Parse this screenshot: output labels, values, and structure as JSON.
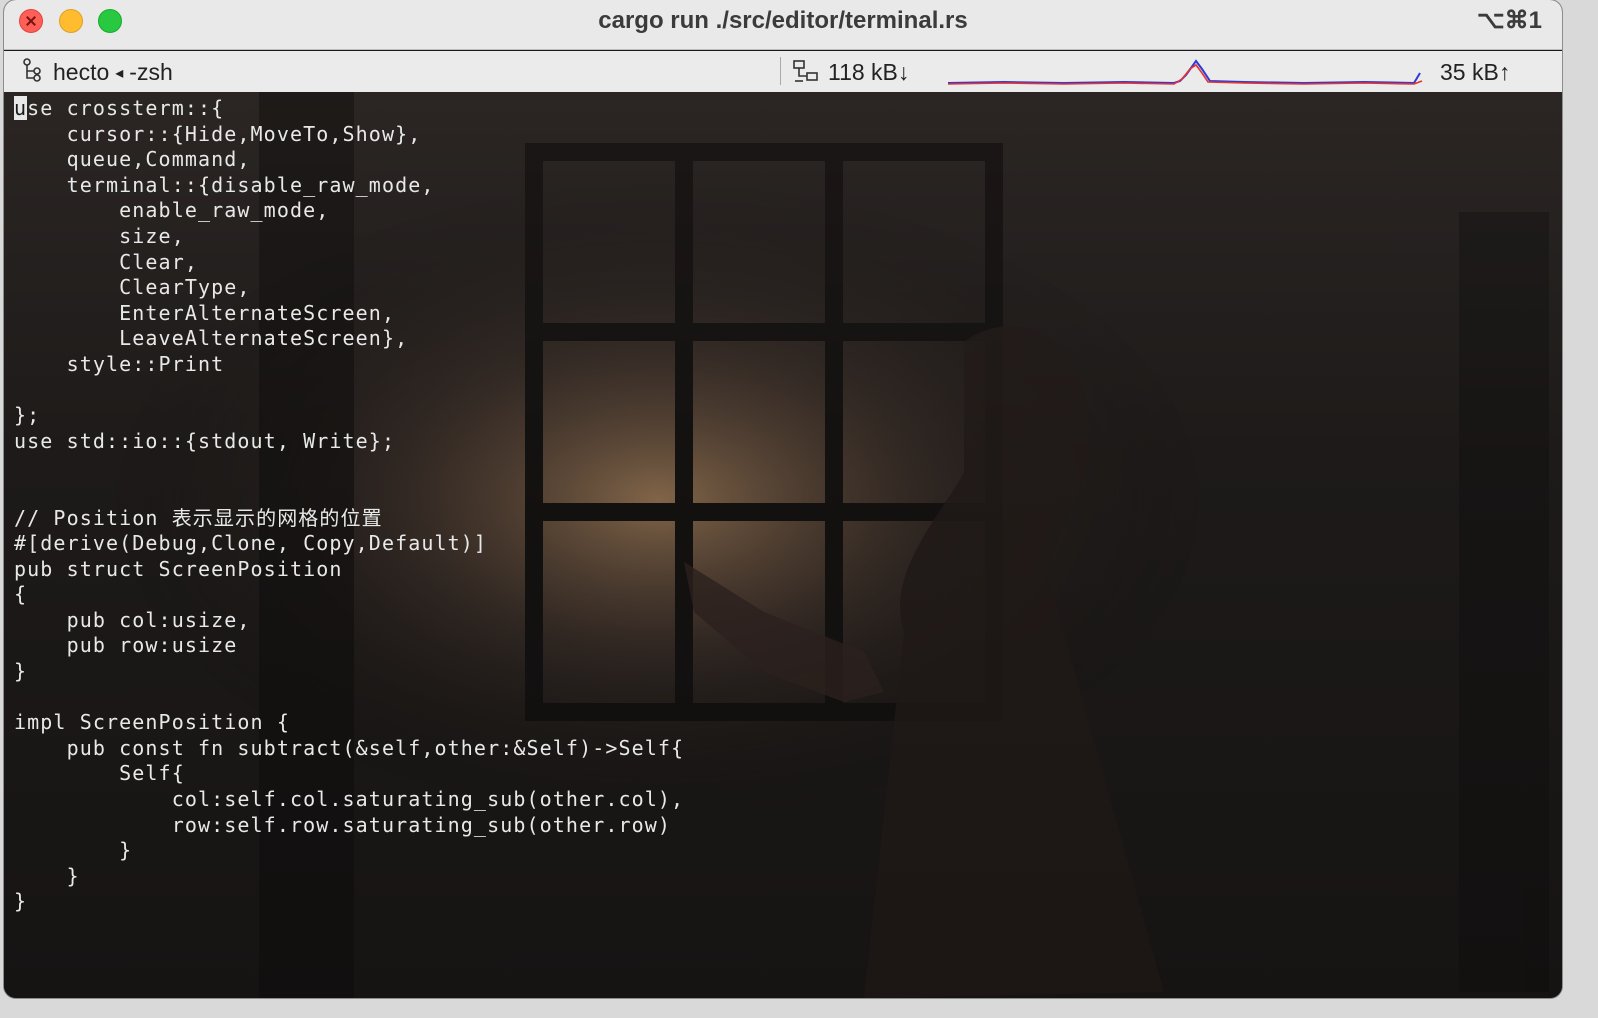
{
  "window": {
    "title": "cargo run ./src/editor/terminal.rs",
    "shortcut": "⌥⌘1"
  },
  "statusbar": {
    "process": "hecto",
    "separator": "◂",
    "shell": "-zsh",
    "net_in": "118 kB↓",
    "net_out": "35 kB↑"
  },
  "terminal": {
    "cursor_char": "u",
    "code_after_cursor": "se crossterm::{\n    cursor::{Hide,MoveTo,Show},\n    queue,Command,\n    terminal::{disable_raw_mode,\n        enable_raw_mode,\n        size,\n        Clear,\n        ClearType,\n        EnterAlternateScreen,\n        LeaveAlternateScreen},\n    style::Print\n\n};\nuse std::io::{stdout, Write};\n\n\n// Position 表示显示的网格的位置\n#[derive(Debug,Clone, Copy,Default)]\npub struct ScreenPosition\n{\n    pub col:usize,\n    pub row:usize\n}\n\nimpl ScreenPosition {\n    pub const fn subtract(&self,other:&Self)->Self{\n        Self{\n            col:self.col.saturating_sub(other.col),\n            row:self.row.saturating_sub(other.row)\n        }\n    }\n}"
  },
  "colors": {
    "titlebar": "#e9e9e9",
    "text": "#e8e8e8",
    "spark_red": "#e8322e",
    "spark_blue": "#2a3bd8"
  }
}
